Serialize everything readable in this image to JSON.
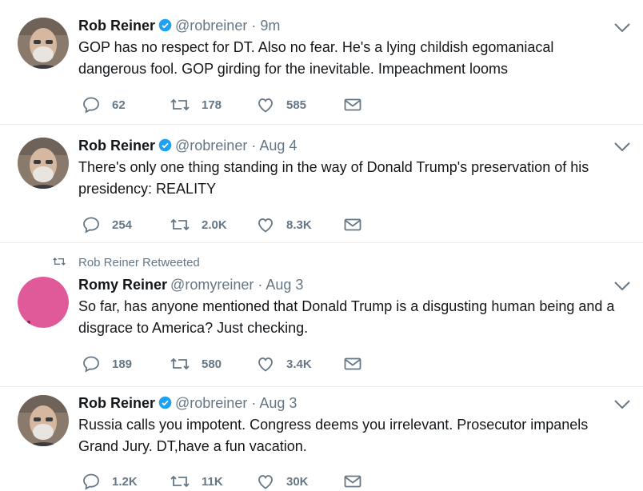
{
  "tweets": [
    {
      "name": "Rob Reiner",
      "verified": true,
      "handle": "@robreiner",
      "separator": "·",
      "time": "9m",
      "text": "GOP has no respect for DT. Also no fear. He's a lying childish egomaniacal dangerous fool. GOP girding for the inevitable. Impeachment looms",
      "replies": "62",
      "retweets": "178",
      "likes": "585",
      "avatar": "rob-reiner-photo"
    },
    {
      "name": "Rob Reiner",
      "verified": true,
      "handle": "@robreiner",
      "separator": "·",
      "time": "Aug 4",
      "text": "There's only one thing standing in the way of Donald Trump's preservation of his presidency: REALITY",
      "replies": "254",
      "retweets": "2.0K",
      "likes": "8.3K",
      "avatar": "rob-reiner-photo"
    },
    {
      "retweeted_by": "Rob Reiner Retweeted",
      "name": "Romy Reiner",
      "verified": false,
      "handle": "@romyreiner",
      "separator": "·",
      "time": "Aug 3",
      "text": "So far, has anyone mentioned that Donald Trump is a disgusting human being and a disgrace to America? Just checking.",
      "replies": "189",
      "retweets": "580",
      "likes": "3.4K",
      "avatar": "pink-circle"
    },
    {
      "name": "Rob Reiner",
      "verified": true,
      "handle": "@robreiner",
      "separator": "·",
      "time": "Aug 3",
      "text": "Russia calls you impotent. Congress deems you irrelevant. Prosecutor impanels Grand Jury. DT,have a fun vacation.",
      "replies": "1.2K",
      "retweets": "11K",
      "likes": "30K",
      "avatar": "rob-reiner-photo"
    }
  ],
  "colors": {
    "text": "#14171a",
    "secondary": "#657786",
    "verified": "#1da1f2",
    "divider": "#e6ecf0",
    "romy_avatar": "#e05a9a"
  }
}
